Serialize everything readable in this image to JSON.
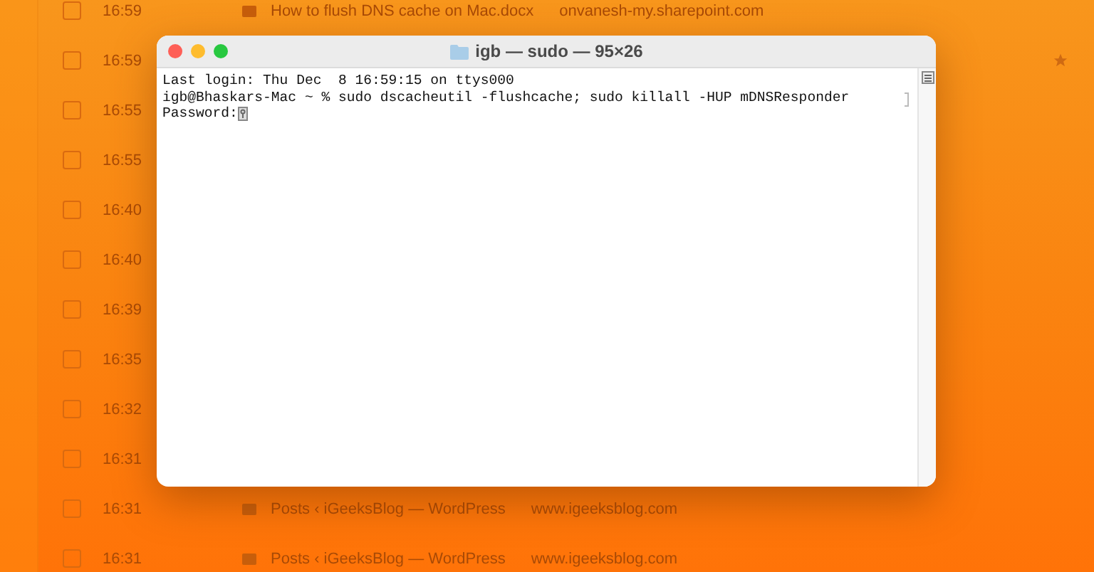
{
  "list": {
    "rows": [
      {
        "time": "16:59",
        "title": "How to flush DNS cache on Mac.docx",
        "source": "onvanesh-my.sharepoint.com",
        "checked": false,
        "starred": false
      },
      {
        "time": "16:59",
        "checked": false,
        "starred": true
      },
      {
        "time": "16:55",
        "checked": false,
        "starred": false
      },
      {
        "time": "16:55",
        "checked": false,
        "starred": false
      },
      {
        "time": "16:40",
        "checked": false,
        "starred": false
      },
      {
        "time": "16:40",
        "checked": false,
        "starred": false
      },
      {
        "time": "16:39",
        "checked": false,
        "starred": false
      },
      {
        "time": "16:35",
        "checked": false,
        "starred": false
      },
      {
        "time": "16:32",
        "checked": false,
        "starred": false
      },
      {
        "time": "16:31",
        "checked": false,
        "starred": false
      },
      {
        "time": "16:31",
        "title": "Posts ‹ iGeeksBlog — WordPress",
        "source": "www.igeeksblog.com",
        "checked": false,
        "starred": false
      },
      {
        "time": "16:31",
        "title": "Posts ‹ iGeeksBlog — WordPress",
        "source": "www.igeeksblog.com",
        "checked": false,
        "starred": false
      }
    ]
  },
  "terminal": {
    "title": "igb — sudo — 95×26",
    "lines": [
      "Last login: Thu Dec  8 16:59:15 on ttys000",
      "igb@Bhaskars-Mac ~ % sudo dscacheutil -flushcache; sudo killall -HUP mDNSResponder"
    ],
    "prompt": "Password:"
  }
}
